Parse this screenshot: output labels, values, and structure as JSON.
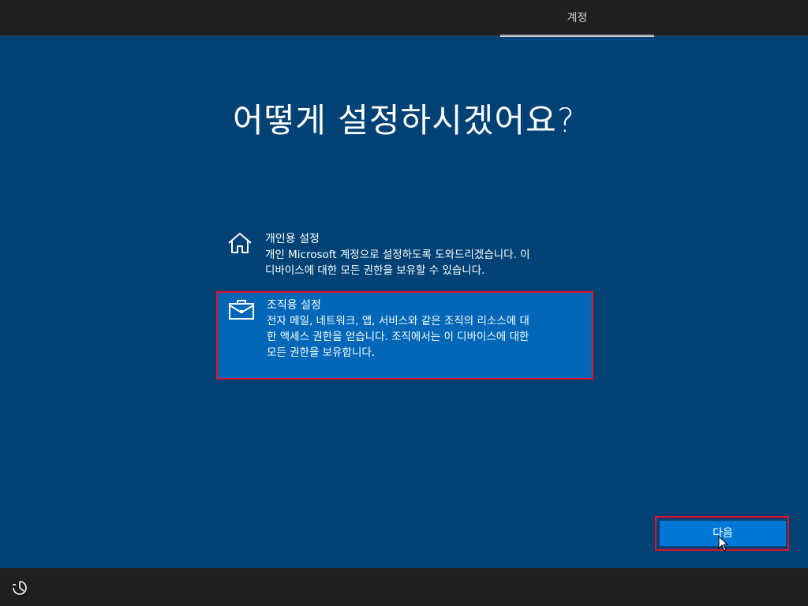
{
  "header": {
    "tabs": [
      {
        "label": "계정",
        "active": true
      }
    ]
  },
  "main": {
    "title": "어떻게 설정하시겠어요?",
    "options": [
      {
        "icon": "home-icon",
        "title": "개인용 설정",
        "description_lines": [
          "개인 Microsoft 계정으로 설정하도록 도와드리겠습니다. 이",
          "디바이스에 대한 모든 권한을 보유할 수 있습니다."
        ],
        "selected": false
      },
      {
        "icon": "briefcase-icon",
        "title": "조직용 설정",
        "description_lines": [
          "전자 메일, 네트워크, 앱, 서비스와 같은 조직의 리소스에 대",
          "한 액세스 권한을 얻습니다. 조직에서는 이 디바이스에 대한",
          "모든 권한을 보유합니다."
        ],
        "selected": true
      }
    ],
    "next_label": "다음"
  },
  "footer": {
    "icon": "accessibility-icon"
  },
  "colors": {
    "background": "#004275",
    "bar": "#1f1f1f",
    "selected_option": "#0067b8",
    "button": "#0078d7",
    "highlight_border": "#e81123"
  }
}
